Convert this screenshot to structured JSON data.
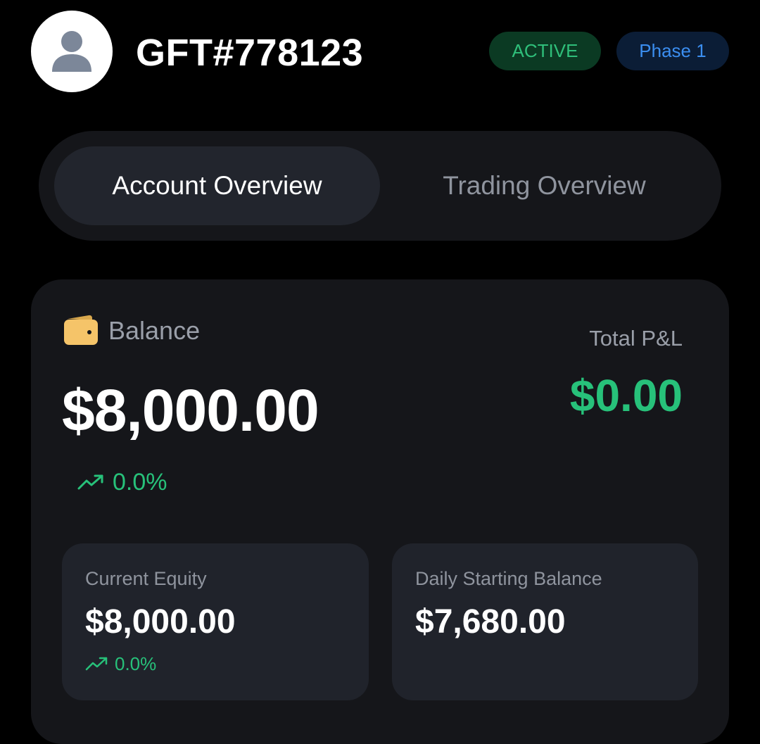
{
  "header": {
    "account_id": "GFT#778123",
    "status_badge": "ACTIVE",
    "phase_badge": "Phase 1"
  },
  "tabs": [
    {
      "label": "Account Overview",
      "selected": true
    },
    {
      "label": "Trading Overview",
      "selected": false
    }
  ],
  "balance_card": {
    "balance_label": "Balance",
    "balance_value": "$8,000.00",
    "balance_change": "0.0%",
    "total_pnl_label": "Total P&L",
    "total_pnl_value": "$0.00"
  },
  "current_equity": {
    "label": "Current Equity",
    "value": "$8,000.00",
    "change": "0.0%"
  },
  "daily_starting_balance": {
    "label": "Daily Starting Balance",
    "value": "$7,680.00"
  },
  "icons": {
    "avatar": "user-icon",
    "balance": "wallet-icon",
    "change": "trending-up-icon"
  },
  "colors": {
    "background": "#000000",
    "card": "#15161a",
    "sub_card": "#20232b",
    "positive": "#27c17a",
    "active_badge_bg": "#0b3a23",
    "phase_badge_bg": "#0b1d36",
    "phase_text": "#3b8ef0",
    "wallet": "#f5c469"
  }
}
